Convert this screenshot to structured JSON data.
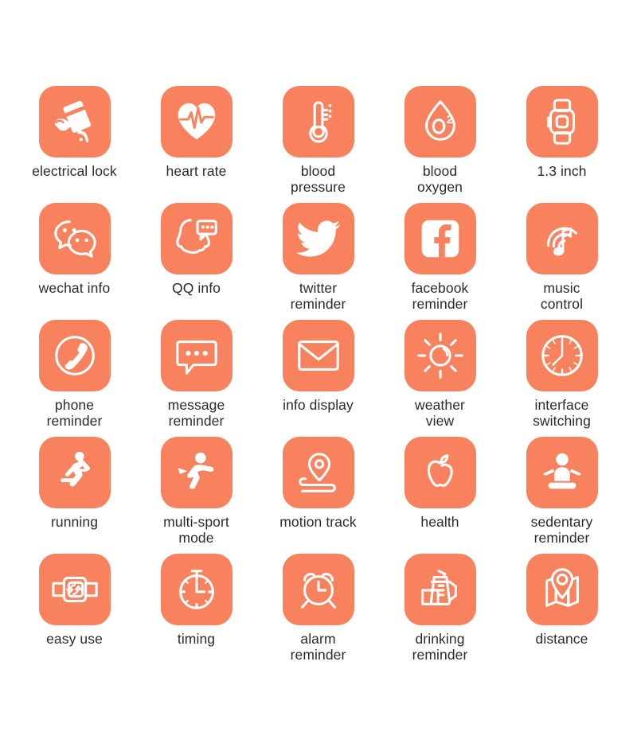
{
  "theme": {
    "tile_color": "#f7825d",
    "icon_color": "#ffffff",
    "label_color": "#2b2b2b",
    "background_color": "#ffffff"
  },
  "grid": {
    "columns": 5,
    "rows": 5,
    "features": [
      {
        "id": "electrical-lock",
        "label": "electrical lock",
        "icon": "card-swipe-nfc-icon"
      },
      {
        "id": "heart-rate",
        "label": "heart rate",
        "icon": "heart-pulse-icon"
      },
      {
        "id": "blood-pressure",
        "label": "blood\npressure",
        "icon": "thermometer-icon"
      },
      {
        "id": "blood-oxygen",
        "label": "blood\noxygen",
        "icon": "blood-drop-o2-icon"
      },
      {
        "id": "screen-size",
        "label": "1.3 inch",
        "icon": "smartwatch-icon"
      },
      {
        "id": "wechat-info",
        "label": "wechat info",
        "icon": "wechat-icon"
      },
      {
        "id": "qq-info",
        "label": "QQ info",
        "icon": "qq-penguin-icon"
      },
      {
        "id": "twitter-reminder",
        "label": "twitter\nreminder",
        "icon": "twitter-bird-icon"
      },
      {
        "id": "facebook-reminder",
        "label": "facebook\nreminder",
        "icon": "facebook-icon"
      },
      {
        "id": "music-control",
        "label": "music\ncontrol",
        "icon": "music-note-waves-icon"
      },
      {
        "id": "phone-reminder",
        "label": "phone\nreminder",
        "icon": "phone-handset-circle-icon"
      },
      {
        "id": "message-reminder",
        "label": "message\nreminder",
        "icon": "speech-bubble-dots-icon"
      },
      {
        "id": "info-display",
        "label": "info display",
        "icon": "envelope-icon"
      },
      {
        "id": "weather-view",
        "label": "weather\nview",
        "icon": "sun-icon"
      },
      {
        "id": "interface-switching",
        "label": "interface\nswitching",
        "icon": "clock-face-icon"
      },
      {
        "id": "running",
        "label": "running",
        "icon": "running-person-icon"
      },
      {
        "id": "multi-sport-mode",
        "label": "multi-sport\nmode",
        "icon": "sport-person-icon"
      },
      {
        "id": "motion-track",
        "label": "motion track",
        "icon": "map-pin-track-icon"
      },
      {
        "id": "health",
        "label": "health",
        "icon": "apple-icon"
      },
      {
        "id": "sedentary-reminder",
        "label": "sedentary\nreminder",
        "icon": "seated-person-icon"
      },
      {
        "id": "easy-use",
        "label": "easy use",
        "icon": "watch-band-icon"
      },
      {
        "id": "timing",
        "label": "timing",
        "icon": "stopwatch-icon"
      },
      {
        "id": "alarm-reminder",
        "label": "alarm\nreminder",
        "icon": "alarm-clock-icon"
      },
      {
        "id": "drinking-reminder",
        "label": "drinking\nreminder",
        "icon": "water-kettle-icon"
      },
      {
        "id": "distance",
        "label": "distance",
        "icon": "map-location-pin-icon"
      }
    ]
  }
}
